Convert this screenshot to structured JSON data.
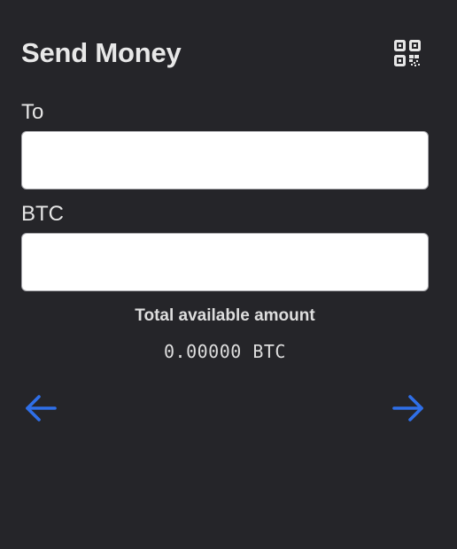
{
  "header": {
    "title": "Send Money",
    "scan_icon": "qr-code-icon"
  },
  "form": {
    "to_label": "To",
    "to_value": "",
    "btc_label": "BTC",
    "btc_value": ""
  },
  "balance": {
    "label": "Total available amount",
    "amount": "0.00000 BTC"
  },
  "navigation": {
    "back_icon": "arrow-left-icon",
    "next_icon": "arrow-right-icon"
  },
  "colors": {
    "background": "#252529",
    "accent": "#2f6fe8",
    "text": "#e6e6e6"
  }
}
